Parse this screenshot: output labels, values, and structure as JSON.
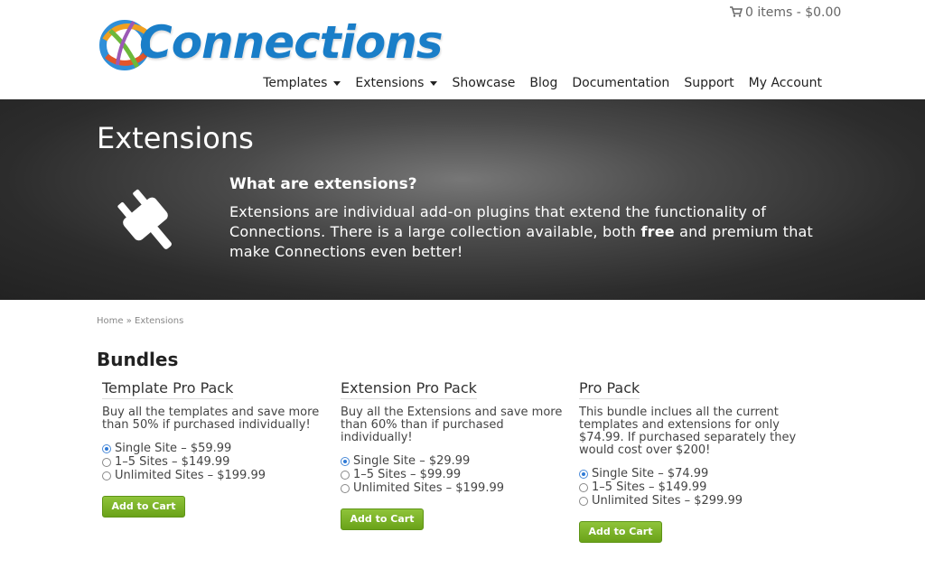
{
  "header": {
    "logo_text": "Connections",
    "cart_text": "0 items - $0.00",
    "nav": [
      {
        "label": "Templates",
        "dropdown": true
      },
      {
        "label": "Extensions",
        "dropdown": true
      },
      {
        "label": "Showcase",
        "dropdown": false
      },
      {
        "label": "Blog",
        "dropdown": false
      },
      {
        "label": "Documentation",
        "dropdown": false
      },
      {
        "label": "Support",
        "dropdown": false
      },
      {
        "label": "My Account",
        "dropdown": false
      }
    ]
  },
  "hero": {
    "title": "Extensions",
    "question": "What are extensions?",
    "text_before": "Extensions are individual add-on plugins that extend the functionality of Connections. There is a large collection available, both ",
    "text_bold": "free",
    "text_after": " and premium that make Connections even better!"
  },
  "breadcrumb": "Home » Extensions",
  "bundles": {
    "title": "Bundles",
    "packs": [
      {
        "name": "Template Pro Pack",
        "description": "Buy all the templates and save more than 50% if purchased individually!",
        "options": [
          "Single Site – $59.99",
          "1–5 Sites – $149.99",
          "Unlimited Sites – $199.99"
        ],
        "selected": 0,
        "button": "Add to Cart"
      },
      {
        "name": "Extension Pro Pack",
        "description": "Buy all the Extensions and save more than 60% than if purchased individually!",
        "options": [
          "Single Site – $29.99",
          "1–5 Sites – $99.99",
          "Unlimited Sites – $199.99"
        ],
        "selected": 0,
        "button": "Add to Cart"
      },
      {
        "name": "Pro Pack",
        "description": "This bundle inclues all the current templates and extensions for only $74.99. If purchased separately they would cost over $200!",
        "options": [
          "Single Site – $74.99",
          "1–5 Sites – $149.99",
          "Unlimited Sites – $299.99"
        ],
        "selected": 0,
        "button": "Add to Cart"
      }
    ]
  },
  "colors": {
    "brand_blue": "#1a7ec8",
    "button_green": "#7ab32a",
    "hero_dark": "#2c2c2c"
  },
  "icons": [
    "shopping-cart-icon",
    "plug-icon",
    "chevron-down-icon"
  ]
}
